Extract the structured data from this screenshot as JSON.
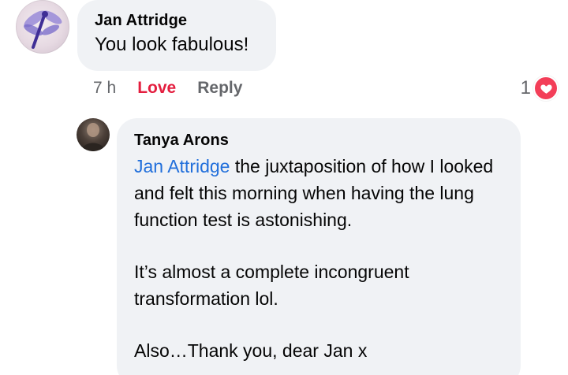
{
  "comments": [
    {
      "author": "Jan Attridge",
      "text": "You look fabulous!",
      "meta": {
        "time": "7 h",
        "love_label": "Love",
        "reply_label": "Reply"
      },
      "reaction": {
        "count": "1",
        "icon": "love-heart-icon",
        "color": "#f33e58"
      }
    },
    {
      "author": "Tanya Arons",
      "mention": "Jan Attridge",
      "paragraphs": [
        " the juxtaposition of how I looked and felt this morning when having the lung function test is astonishing.",
        "It’s almost a complete incongruent transformation lol.",
        "Also…Thank you, dear Jan x"
      ]
    }
  ],
  "colors": {
    "bubble": "#f0f2f5",
    "love": "#e41e3f",
    "mention": "#216fdb",
    "meta": "#65676b"
  }
}
